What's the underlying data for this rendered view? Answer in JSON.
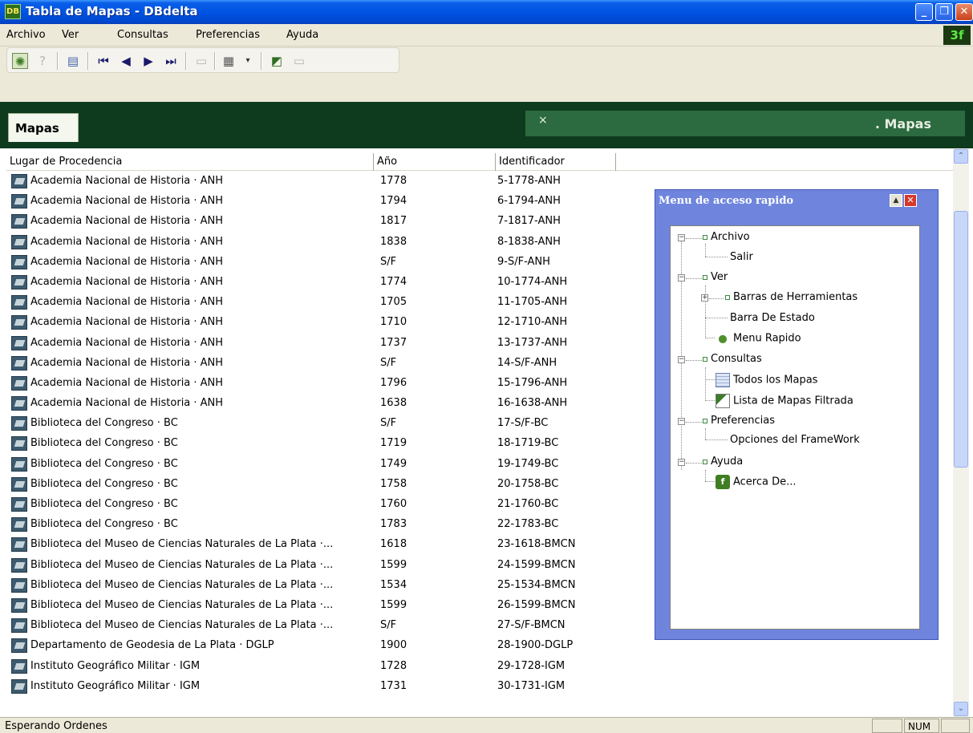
{
  "window": {
    "app_icon_text": "DB",
    "title": "Tabla de Mapas - DBdelta",
    "min_glyph": "_",
    "max_glyph": "❐",
    "close_glyph": "✕"
  },
  "menu": {
    "items": [
      "Archivo",
      "Ver",
      "Consultas",
      "Preferencias",
      "Ayuda"
    ],
    "logo": "3f"
  },
  "toolbar": {
    "icons": [
      "menu-rapido-icon",
      "help-icon",
      "table-icon",
      "first-record-icon",
      "prev-record-icon",
      "next-record-icon",
      "last-record-icon",
      "blank-icon",
      "grid-view-icon",
      "dropdown-icon",
      "filter-icon",
      "disabled-icon"
    ]
  },
  "tabs": {
    "active": "Mapas",
    "panel_close": "×",
    "panel_title": ". Mapas"
  },
  "grid": {
    "columns": [
      "Lugar de Procedencia",
      "Año",
      "Identificador"
    ],
    "rows": [
      [
        "Academia Nacional de Historia · ANH",
        "1778",
        "5-1778-ANH"
      ],
      [
        "Academia Nacional de Historia · ANH",
        "1794",
        "6-1794-ANH"
      ],
      [
        "Academia Nacional de Historia · ANH",
        "1817",
        "7-1817-ANH"
      ],
      [
        "Academia Nacional de Historia · ANH",
        "1838",
        "8-1838-ANH"
      ],
      [
        "Academia Nacional de Historia · ANH",
        "S/F",
        "9-S/F-ANH"
      ],
      [
        "Academia Nacional de Historia · ANH",
        "1774",
        "10-1774-ANH"
      ],
      [
        "Academia Nacional de Historia · ANH",
        "1705",
        "11-1705-ANH"
      ],
      [
        "Academia Nacional de Historia · ANH",
        "1710",
        "12-1710-ANH"
      ],
      [
        "Academia Nacional de Historia · ANH",
        "1737",
        "13-1737-ANH"
      ],
      [
        "Academia Nacional de Historia · ANH",
        "S/F",
        "14-S/F-ANH"
      ],
      [
        "Academia Nacional de Historia · ANH",
        "1796",
        "15-1796-ANH"
      ],
      [
        "Academia Nacional de Historia · ANH",
        "1638",
        "16-1638-ANH"
      ],
      [
        "Biblioteca del Congreso · BC",
        "S/F",
        "17-S/F-BC"
      ],
      [
        "Biblioteca del Congreso · BC",
        "1719",
        "18-1719-BC"
      ],
      [
        "Biblioteca del Congreso · BC",
        "1749",
        "19-1749-BC"
      ],
      [
        "Biblioteca del Congreso · BC",
        "1758",
        "20-1758-BC"
      ],
      [
        "Biblioteca del Congreso · BC",
        "1760",
        "21-1760-BC"
      ],
      [
        "Biblioteca del Congreso · BC",
        "1783",
        "22-1783-BC"
      ],
      [
        "Biblioteca del Museo de Ciencias Naturales de La Plata ·...",
        "1618",
        "23-1618-BMCN"
      ],
      [
        "Biblioteca del Museo de Ciencias Naturales de La Plata ·...",
        "1599",
        "24-1599-BMCN"
      ],
      [
        "Biblioteca del Museo de Ciencias Naturales de La Plata ·...",
        "1534",
        "25-1534-BMCN"
      ],
      [
        "Biblioteca del Museo de Ciencias Naturales de La Plata ·...",
        "1599",
        "26-1599-BMCN"
      ],
      [
        "Biblioteca del Museo de Ciencias Naturales de La Plata ·...",
        "S/F",
        "27-S/F-BMCN"
      ],
      [
        "Departamento de Geodesia de La Plata · DGLP",
        "1900",
        "28-1900-DGLP"
      ],
      [
        "Instituto Geográfico Militar · IGM",
        "1728",
        "29-1728-IGM"
      ],
      [
        "Instituto Geográfico Militar · IGM",
        "1731",
        "30-1731-IGM"
      ]
    ]
  },
  "scrollbar": {
    "up_glyph": "⌃",
    "down_glyph": "⌄"
  },
  "quick_menu": {
    "title": "Menu de acceso rapido",
    "min_glyph": "▲",
    "close_glyph": "✕",
    "tree": {
      "archivo": "Archivo",
      "salir": "Salir",
      "ver": "Ver",
      "barras": "Barras de Herramientas",
      "barra_estado": "Barra De Estado",
      "menu_rapido": "Menu Rapido",
      "consultas": "Consultas",
      "todos": "Todos los Mapas",
      "lista": "Lista de Mapas Filtrada",
      "preferencias": "Preferencias",
      "opciones": "Opciones del FrameWork",
      "ayuda": "Ayuda",
      "acerca": "Acerca De..."
    },
    "collapse_glyph": "−",
    "expand_glyph": "+",
    "app_icon_text": "f"
  },
  "status": {
    "text": "Esperando Ordenes",
    "num": "NUM"
  }
}
